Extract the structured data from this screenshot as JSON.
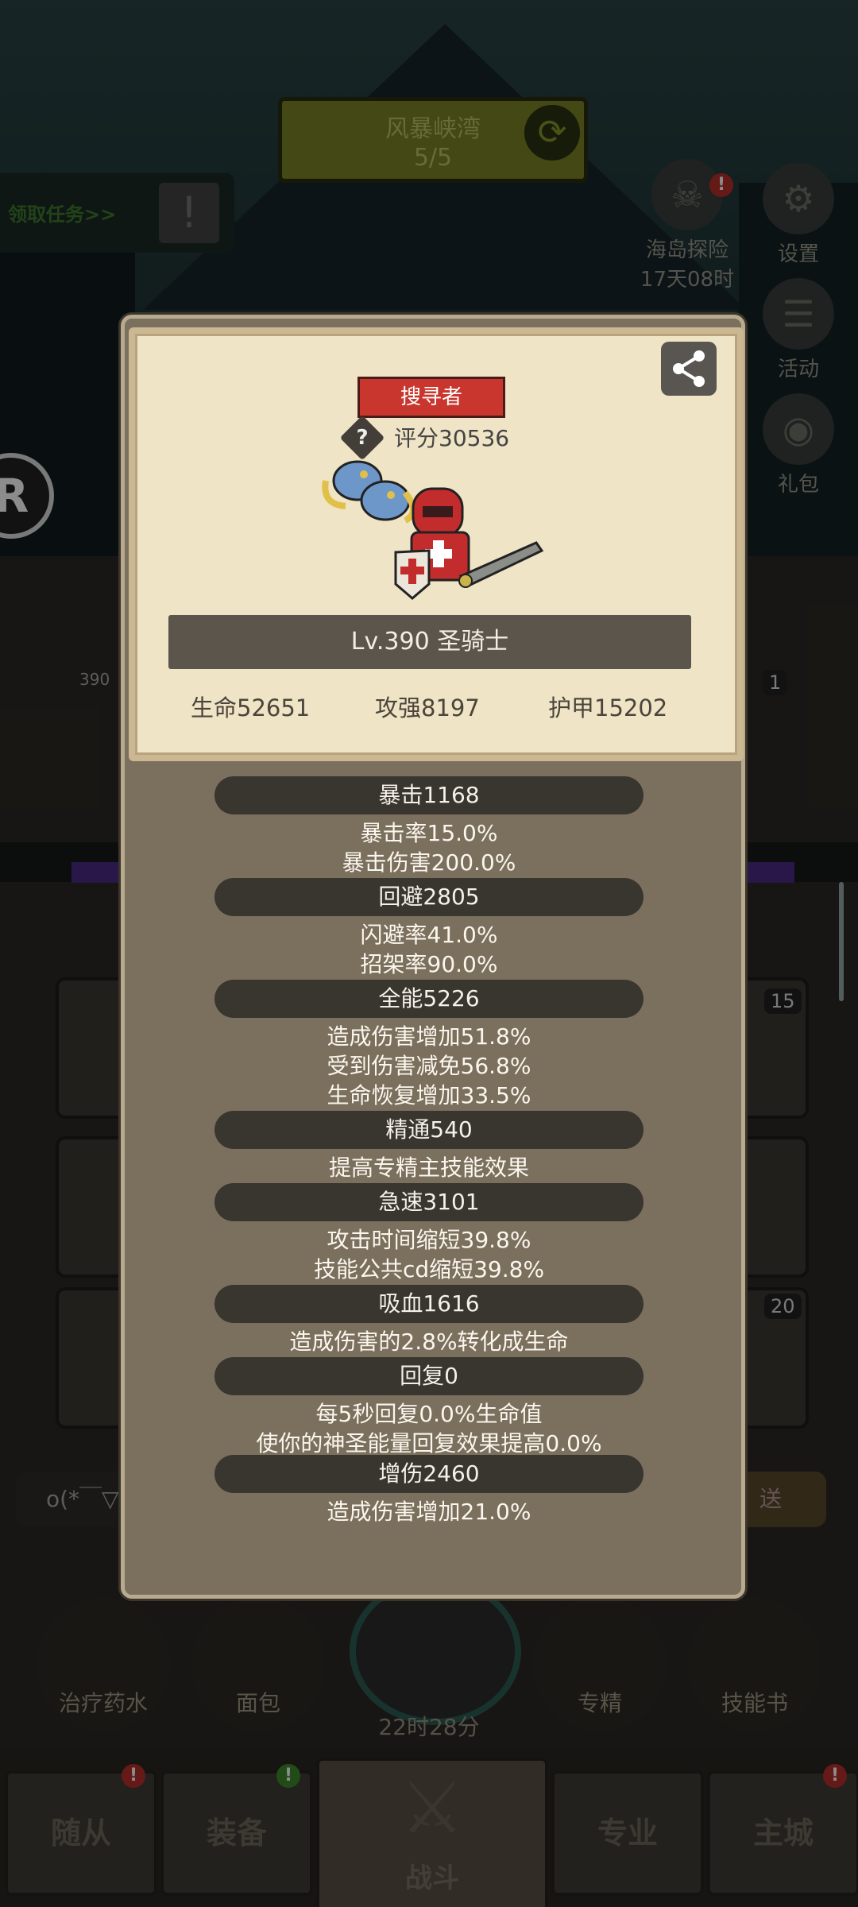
{
  "background": {
    "top_banner": {
      "title": "风暴峡湾",
      "progress": "5/5"
    },
    "quest_link": "领取任务>>",
    "side_icons": [
      {
        "label": "海岛探险",
        "sub": "17天08时"
      },
      {
        "label": "设置"
      },
      {
        "label": "活动"
      },
      {
        "label": "礼包"
      }
    ],
    "level_tag": "390",
    "slot_badges": [
      "1",
      "15",
      "20"
    ],
    "chat_text": "o(*￣▽",
    "send_label": "送",
    "quick_items": [
      "治疗药水",
      "面包",
      "专精",
      "技能书"
    ],
    "chest_timer": "22时28分",
    "nav": [
      "随从",
      "装备",
      "战斗",
      "专业",
      "主城"
    ]
  },
  "profile": {
    "title_badge": "搜寻者",
    "score": "评分30536",
    "level_name": "Lv.390 圣骑士",
    "hp": "生命52651",
    "attack": "攻强8197",
    "armor": "护甲15202"
  },
  "stats": [
    {
      "header": "暴击1168",
      "lines": [
        "暴击率15.0%",
        "暴击伤害200.0%"
      ]
    },
    {
      "header": "回避2805",
      "lines": [
        "闪避率41.0%",
        "招架率90.0%"
      ]
    },
    {
      "header": "全能5226",
      "lines": [
        "造成伤害增加51.8%",
        "受到伤害减免56.8%",
        "生命恢复增加33.5%"
      ]
    },
    {
      "header": "精通540",
      "lines": [
        "提高专精主技能效果"
      ]
    },
    {
      "header": "急速3101",
      "lines": [
        "攻击时间缩短39.8%",
        "技能公共cd缩短39.8%"
      ]
    },
    {
      "header": "吸血1616",
      "lines": [
        "造成伤害的2.8%转化成生命"
      ]
    },
    {
      "header": "回复0",
      "lines": [
        "每5秒回复0.0%生命值",
        "使你的神圣能量回复效果提高0.0%"
      ]
    },
    {
      "header": "增伤2460",
      "lines": [
        "造成伤害增加21.0%"
      ]
    }
  ]
}
